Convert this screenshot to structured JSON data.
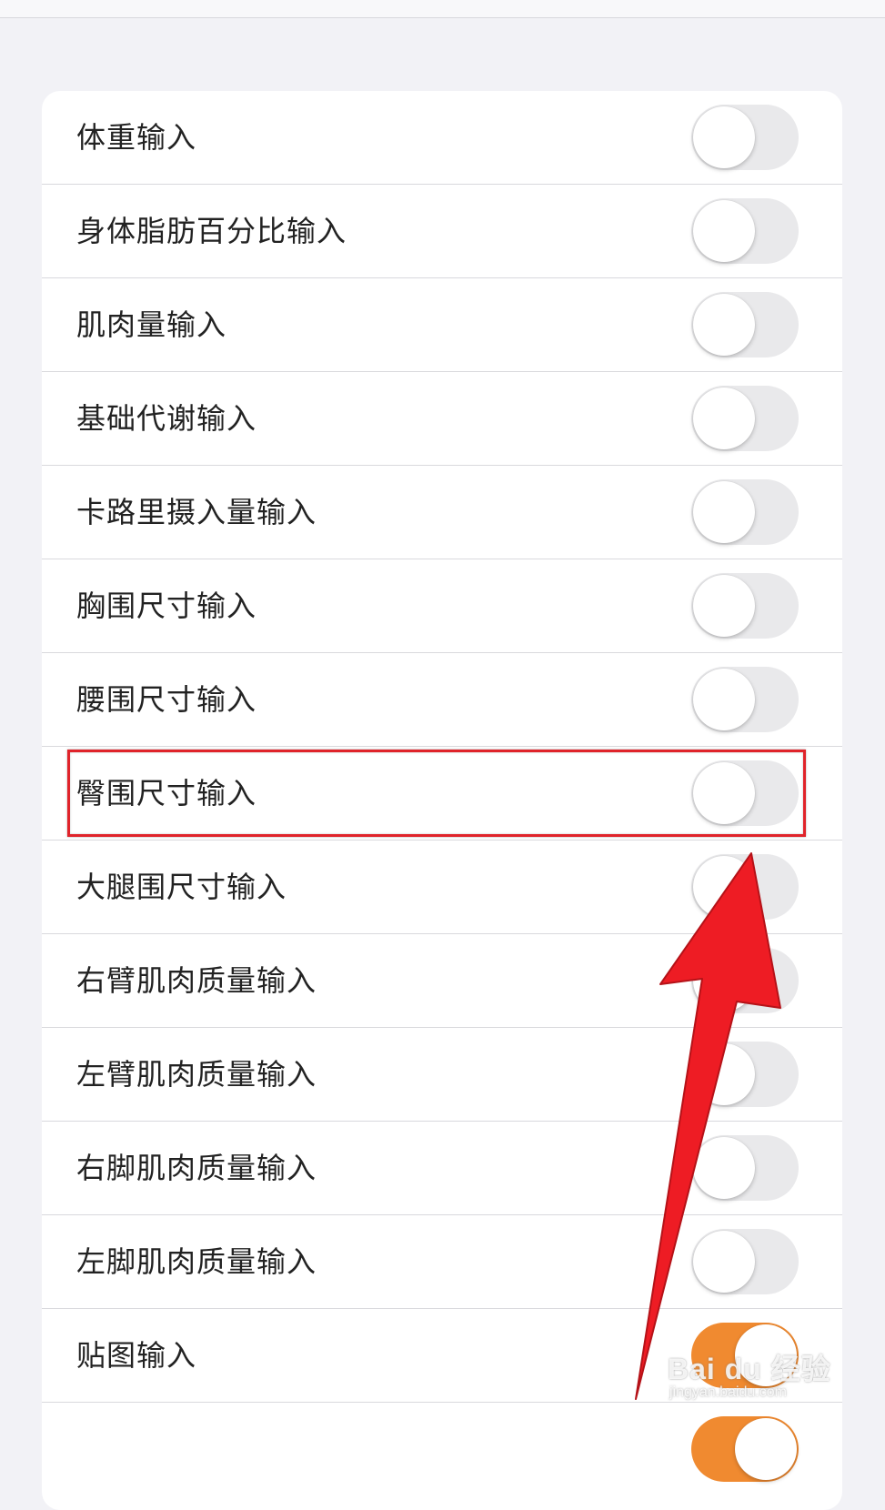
{
  "settings": {
    "items": [
      {
        "label": "体重输入",
        "on": false
      },
      {
        "label": "身体脂肪百分比输入",
        "on": false
      },
      {
        "label": "肌肉量输入",
        "on": false
      },
      {
        "label": "基础代谢输入",
        "on": false
      },
      {
        "label": "卡路里摄入量输入",
        "on": false
      },
      {
        "label": "胸围尺寸输入",
        "on": false
      },
      {
        "label": "腰围尺寸输入",
        "on": false
      },
      {
        "label": "臀围尺寸输入",
        "on": false
      },
      {
        "label": "大腿围尺寸输入",
        "on": false
      },
      {
        "label": "右臂肌肉质量输入",
        "on": false
      },
      {
        "label": "左臂肌肉质量输入",
        "on": false
      },
      {
        "label": "右脚肌肉质量输入",
        "on": false
      },
      {
        "label": "左脚肌肉质量输入",
        "on": false
      },
      {
        "label": "贴图输入",
        "on": true
      },
      {
        "label": "",
        "on": true
      }
    ]
  },
  "colors": {
    "toggle_on": "#f08a30",
    "toggle_off": "#e9e9eb",
    "annotation": "#e0232a"
  },
  "annotation": {
    "highlighted_item": "臀围尺寸输入",
    "arrow_icon": "red-arrow-icon"
  },
  "watermark": {
    "brand": "Bai du 经验",
    "url": "jingyan.baidu.com"
  }
}
